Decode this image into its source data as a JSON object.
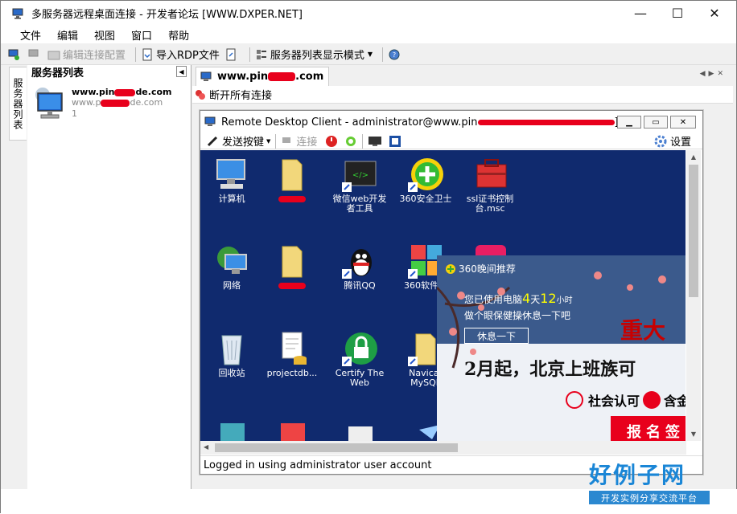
{
  "window": {
    "title": "多服务器远程桌面连接 - 开发者论坛 [WWW.DXPER.NET]"
  },
  "menu": [
    "文件",
    "编辑",
    "视图",
    "窗口",
    "帮助"
  ],
  "toolbar": {
    "edit_conn": "编辑连接配置",
    "import_rdp": "导入RDP文件",
    "list_mode": "服务器列表显示模式"
  },
  "left_tab": "服务器列表",
  "left_panel": {
    "title": "服务器列表",
    "server": {
      "name_prefix": "www.pin",
      "name_suffix": "de.com",
      "addr_prefix": "www.p",
      "addr_suffix": "de.com",
      "port": "1"
    }
  },
  "doc_tab": {
    "label_prefix": "www.pin",
    "label_suffix": ".com"
  },
  "subbar": {
    "disconnect_all": "断开所有连接"
  },
  "rdp": {
    "title_prefix": "Remote Desktop Client - administrator@www.pin",
    "title_suffix": "]",
    "send_keys": "发送按键",
    "connect": "连接",
    "settings": "设置",
    "status": "Logged in using administrator user account"
  },
  "desktop_icons": [
    {
      "label": "计算机"
    },
    {
      "label": ""
    },
    {
      "label": "微信web开发者工具"
    },
    {
      "label": "360安全卫士"
    },
    {
      "label": "ssl证书控制台.msc"
    },
    {
      "label": "网络"
    },
    {
      "label": ""
    },
    {
      "label": "腾讯QQ"
    },
    {
      "label": "360软件管"
    },
    {
      "label": "回收站"
    },
    {
      "label": "projectdb..."
    },
    {
      "label": "Certify The Web"
    },
    {
      "label": "Navicat MySQL"
    }
  ],
  "popup": {
    "header": "360晚间推荐",
    "line1_a": "您已使用电脑",
    "days": "4",
    "line1_b": "天",
    "hours": "12",
    "line1_c": "小时",
    "line2": "做个眼保健操休息一下吧",
    "rest_btn": "休息一下",
    "big_title": "重大",
    "headline": "2月起，北京上班族可",
    "sub_a": "社会认可",
    "sub_b": "含金",
    "cta": "报名签"
  },
  "brand": {
    "name": "好例子网",
    "tagline": "开发实例分享交流平台"
  },
  "colors": {
    "desktop": "#102a6e",
    "accent_red": "#e8001c",
    "brand_blue": "#1a86d6"
  }
}
